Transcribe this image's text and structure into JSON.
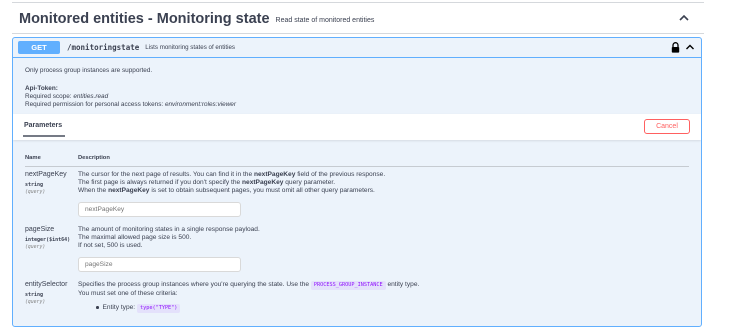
{
  "section": {
    "title": "Monitored entities - Monitoring state",
    "description": "Read state of monitored entities"
  },
  "operation": {
    "method": "GET",
    "path": "/monitoringstate",
    "summary": "Lists monitoring states of entities",
    "description_line": "Only process group instances are supported.",
    "api_token_label": "Api-Token:",
    "required_scope_label": "Required scope: ",
    "required_scope_value": "entities.read",
    "required_permission_label": "Required permission for personal access tokens: ",
    "required_permission_value": "environment:roles:viewer"
  },
  "parameters_tab": {
    "label": "Parameters",
    "cancel_label": "Cancel",
    "col_name": "Name",
    "col_description": "Description"
  },
  "params": [
    {
      "name": "nextPageKey",
      "type": "string",
      "in": "(query)",
      "lines": [
        [
          "The cursor for the next page of results. You can find it in the ",
          "nextPageKey",
          " field of the previous response."
        ],
        [
          "The first page is always returned if you don't specify the ",
          "nextPageKey",
          " query parameter."
        ],
        [
          "When the ",
          "nextPageKey",
          " is set to obtain subsequent pages, you must omit all other query parameters."
        ]
      ],
      "placeholder": "nextPageKey"
    },
    {
      "name": "pageSize",
      "type": "integer($int64)",
      "in": "(query)",
      "lines": [
        "The amount of monitoring states in a single response payload.",
        "The maximal allowed page size is 500.",
        "If not set, 500 is used."
      ],
      "placeholder": "pageSize"
    },
    {
      "name": "entitySelector",
      "type": "string",
      "in": "(query)",
      "line1_pre": "Specifies the process group instances where you're querying the state. Use the ",
      "line1_code": "PROCESS_GROUP_INSTANCE",
      "line1_post": " entity type.",
      "line2": "You must set one of these criteria:",
      "bullet_label": "Entity type: ",
      "bullet_code": "type(\"TYPE\")"
    }
  ],
  "colors": {
    "get_accent": "#61affe",
    "block_bg": "#ecf3fb",
    "cancel": "#ff6060",
    "code_chip": "#9012fe"
  }
}
